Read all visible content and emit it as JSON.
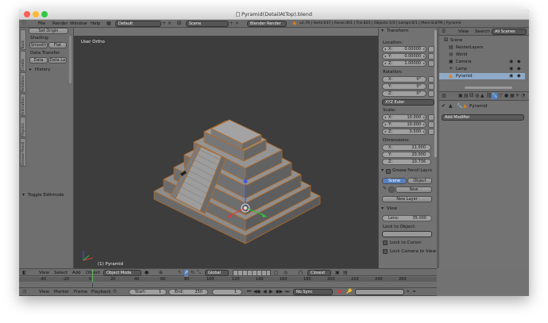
{
  "window": {
    "title": "Pyramid(DetailAtTop).blend"
  },
  "info_header": {
    "menus": [
      "File",
      "Render",
      "Window",
      "Help"
    ],
    "layout": "Default",
    "scene": "Scene",
    "engine": "Blender Render",
    "stats": "v2.79 | Verts:637 | Faces:401 | Tris:825 | Objects:1/3 | Lamps:0/1 | Mem:8.87M | Pyramid"
  },
  "toolshelf": {
    "section_top": "Set Origin",
    "shading_label": "Shading:",
    "smooth": "Smooth",
    "flat": "Flat",
    "data_transfer_label": "Data Transfer:",
    "data": "Data",
    "data_la": "Data La",
    "history": "History",
    "toggle_editmode": "Toggle Editmode",
    "tabs": [
      "Tools",
      "Create",
      "Relations",
      "Animation",
      "Physics",
      "Grease Pencil"
    ]
  },
  "viewport": {
    "view_label": "User Ortho",
    "object_label": "(1) Pyramid"
  },
  "n_panel": {
    "transform_title": "Transform",
    "location_label": "Location:",
    "location": [
      {
        "axis": "X:",
        "value": "0.00000"
      },
      {
        "axis": "Y:",
        "value": "0.00000"
      },
      {
        "axis": "Z:",
        "value": "1.00000"
      }
    ],
    "rotation_label": "Rotation:",
    "rotation": [
      {
        "axis": "X:",
        "value": "0°"
      },
      {
        "axis": "Y:",
        "value": "0°"
      },
      {
        "axis": "Z:",
        "value": "0°"
      }
    ],
    "rotation_mode": "XYZ Euler",
    "scale_label": "Scale:",
    "scale": [
      {
        "axis": "X:",
        "value": "10.000"
      },
      {
        "axis": "Y:",
        "value": "10.000"
      },
      {
        "axis": "Z:",
        "value": "0.500"
      }
    ],
    "dimensions_label": "Dimensions:",
    "dimensions": [
      {
        "axis": "X:",
        "value": "21.000"
      },
      {
        "axis": "Y:",
        "value": "20.000"
      },
      {
        "axis": "Z:",
        "value": "10.736"
      }
    ],
    "grease_title": "Grease Pencil Lay.rs",
    "scene_tab": "Scene",
    "object_tab": "Object",
    "new": "New",
    "new_layer": "New Layer",
    "view_title": "View",
    "lens_label": "Lens:",
    "lens_value": "35.000",
    "lock_to_object": "Lock to Object:",
    "lock_to_cursor": "Lock to Cursor",
    "lock_camera_to_view": "Lock Camera to View"
  },
  "outliner": {
    "tabs": [
      "View",
      "Search",
      "All Scenes"
    ],
    "items": [
      "Scene",
      "RenderLayers",
      "World",
      "Camera",
      "Lamp",
      "Pyramid"
    ]
  },
  "properties": {
    "object_name": "Pyramid",
    "add_modifier": "Add Modifier"
  },
  "view3d_header": {
    "menus": [
      "View",
      "Select",
      "Add",
      "Object"
    ],
    "mode": "Object Mode",
    "orientation": "Global",
    "snap": "Closest"
  },
  "timeline": {
    "ticks": [
      "-40",
      "-20",
      "0",
      "20",
      "40",
      "60",
      "80",
      "100",
      "120",
      "140",
      "160",
      "180",
      "200",
      "220",
      "240",
      "260"
    ],
    "menus": [
      "View",
      "Marker",
      "Frame",
      "Playback"
    ],
    "start_label": "Start:",
    "start": "1",
    "end_label": "End:",
    "end": "250",
    "current": "1",
    "sync": "No Sync"
  }
}
